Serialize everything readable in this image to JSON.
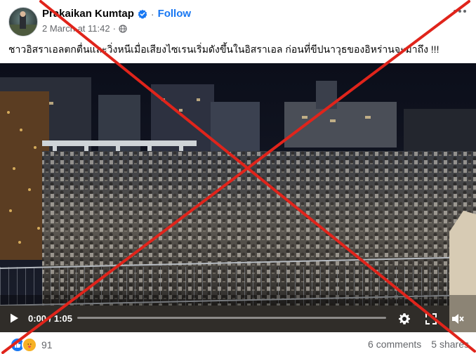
{
  "post": {
    "author": "Prakaikan Kumtap",
    "follow_label": "Follow",
    "date": "2 March at 11:42",
    "caption": "ชาวอิสราเอลตกตื่นและวิ่งหนีเมื่อเสียงไซเรนเริ่มดังขึ้นในอิสราเอล ก่อนที่ขีปนาวุธของอิหร่านจะมาถึง !!!"
  },
  "video": {
    "current_time": "0:00",
    "separator": "/",
    "duration": "1:05",
    "progress": 0.0
  },
  "footer": {
    "reaction_count": "91",
    "comments": "6 comments",
    "shares": "5 shares"
  },
  "colors": {
    "link_blue": "#1877f2",
    "secondary_text": "#65676b",
    "overlay_red": "#e0241b"
  },
  "icons": [
    "verified-badge-icon",
    "globe-icon",
    "more-options-icon",
    "play-icon",
    "settings-icon",
    "fullscreen-icon",
    "volume-muted-icon",
    "like-reaction-icon",
    "care-reaction-icon"
  ]
}
